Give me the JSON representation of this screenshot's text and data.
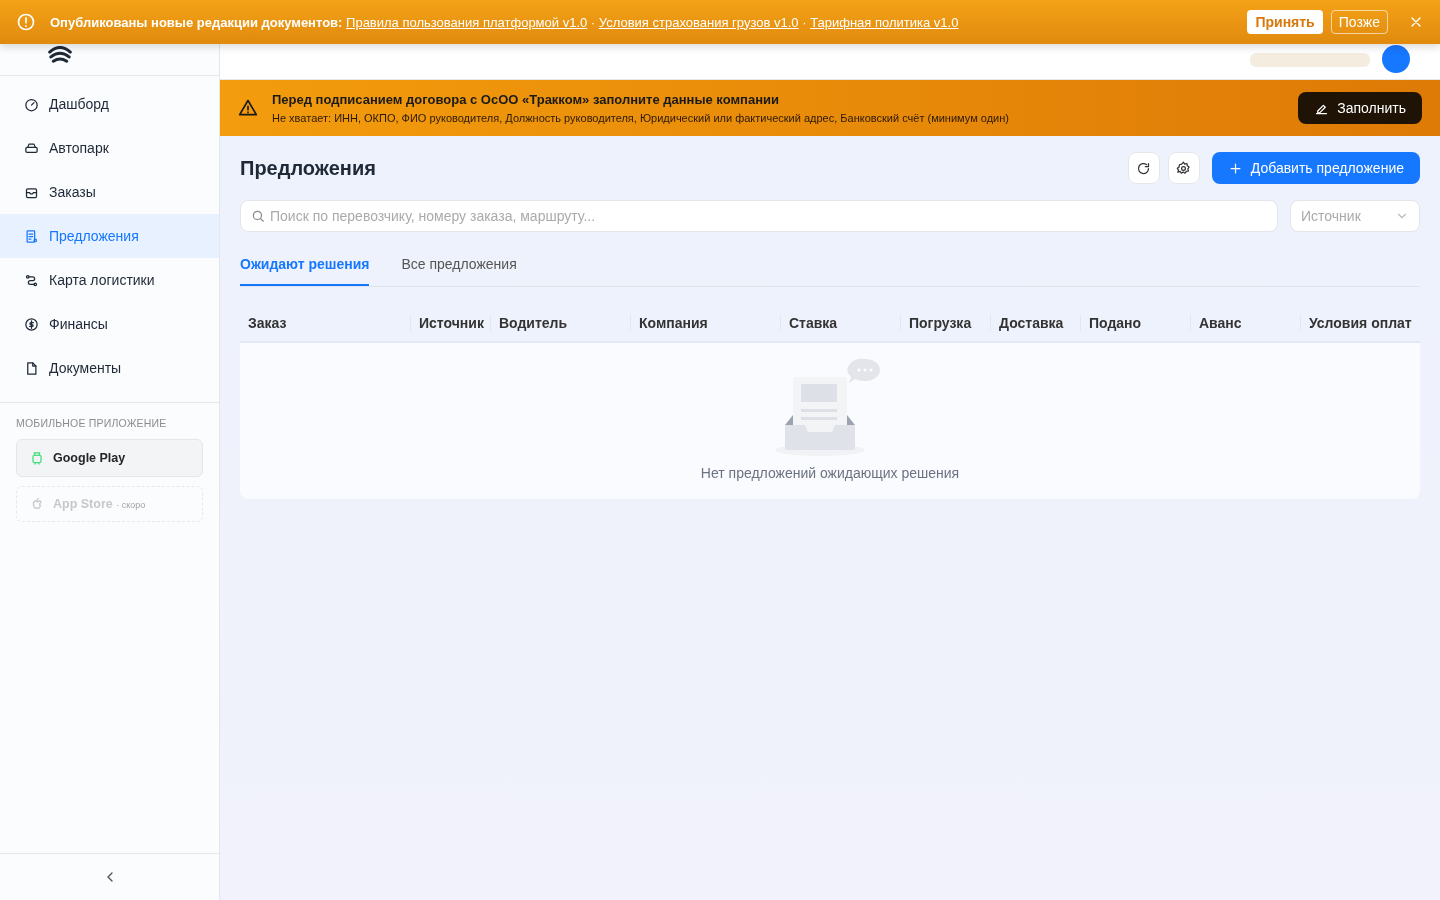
{
  "notice": {
    "title": "Опубликованы новые редакции документов:",
    "links": [
      "Правила пользования платформой v1.0",
      "Условия страхования грузов v1.0",
      "Тарифная политика v1.0"
    ],
    "separator": "·",
    "accept": "Принять",
    "later": "Позже"
  },
  "sidebar": {
    "items": [
      {
        "label": "Дашборд",
        "selected": false
      },
      {
        "label": "Автопарк",
        "selected": false
      },
      {
        "label": "Заказы",
        "selected": false
      },
      {
        "label": "Предложения",
        "selected": true
      },
      {
        "label": "Карта логистики",
        "selected": false
      },
      {
        "label": "Финансы",
        "selected": false
      },
      {
        "label": "Документы",
        "selected": false
      }
    ],
    "mobile_title": "МОБИЛЬНОЕ ПРИЛОЖЕНИЕ",
    "apps": [
      {
        "label": "Google Play",
        "disabled": false
      },
      {
        "label": "App Store",
        "note": "· скоро",
        "disabled": true
      }
    ]
  },
  "warning": {
    "title": "Перед подписанием договора с ОсОО «Тракком» заполните данные компании",
    "text": "Не хватает: ИНН, ОКПО, ФИО руководителя, Должность руководителя, Юридический или фактический адрес, Банковский счёт (минимум один)",
    "button": "Заполнить"
  },
  "page": {
    "title": "Предложения",
    "add_button": "Добавить предложение",
    "search": {
      "placeholder": "Поиск по перевозчику, номеру заказа, маршруту..."
    },
    "source": {
      "placeholder": "Источник"
    },
    "tabs": [
      {
        "label": "Ожидают решения",
        "selected": true
      },
      {
        "label": "Все предложения",
        "selected": false
      }
    ],
    "table": {
      "columns": [
        "Заказ",
        "Источник",
        "Водитель",
        "Компания",
        "Ставка",
        "Погрузка",
        "Доставка",
        "Подано",
        "Аванс",
        "Условия оплат"
      ],
      "empty": "Нет предложений ожидающих решения"
    }
  }
}
